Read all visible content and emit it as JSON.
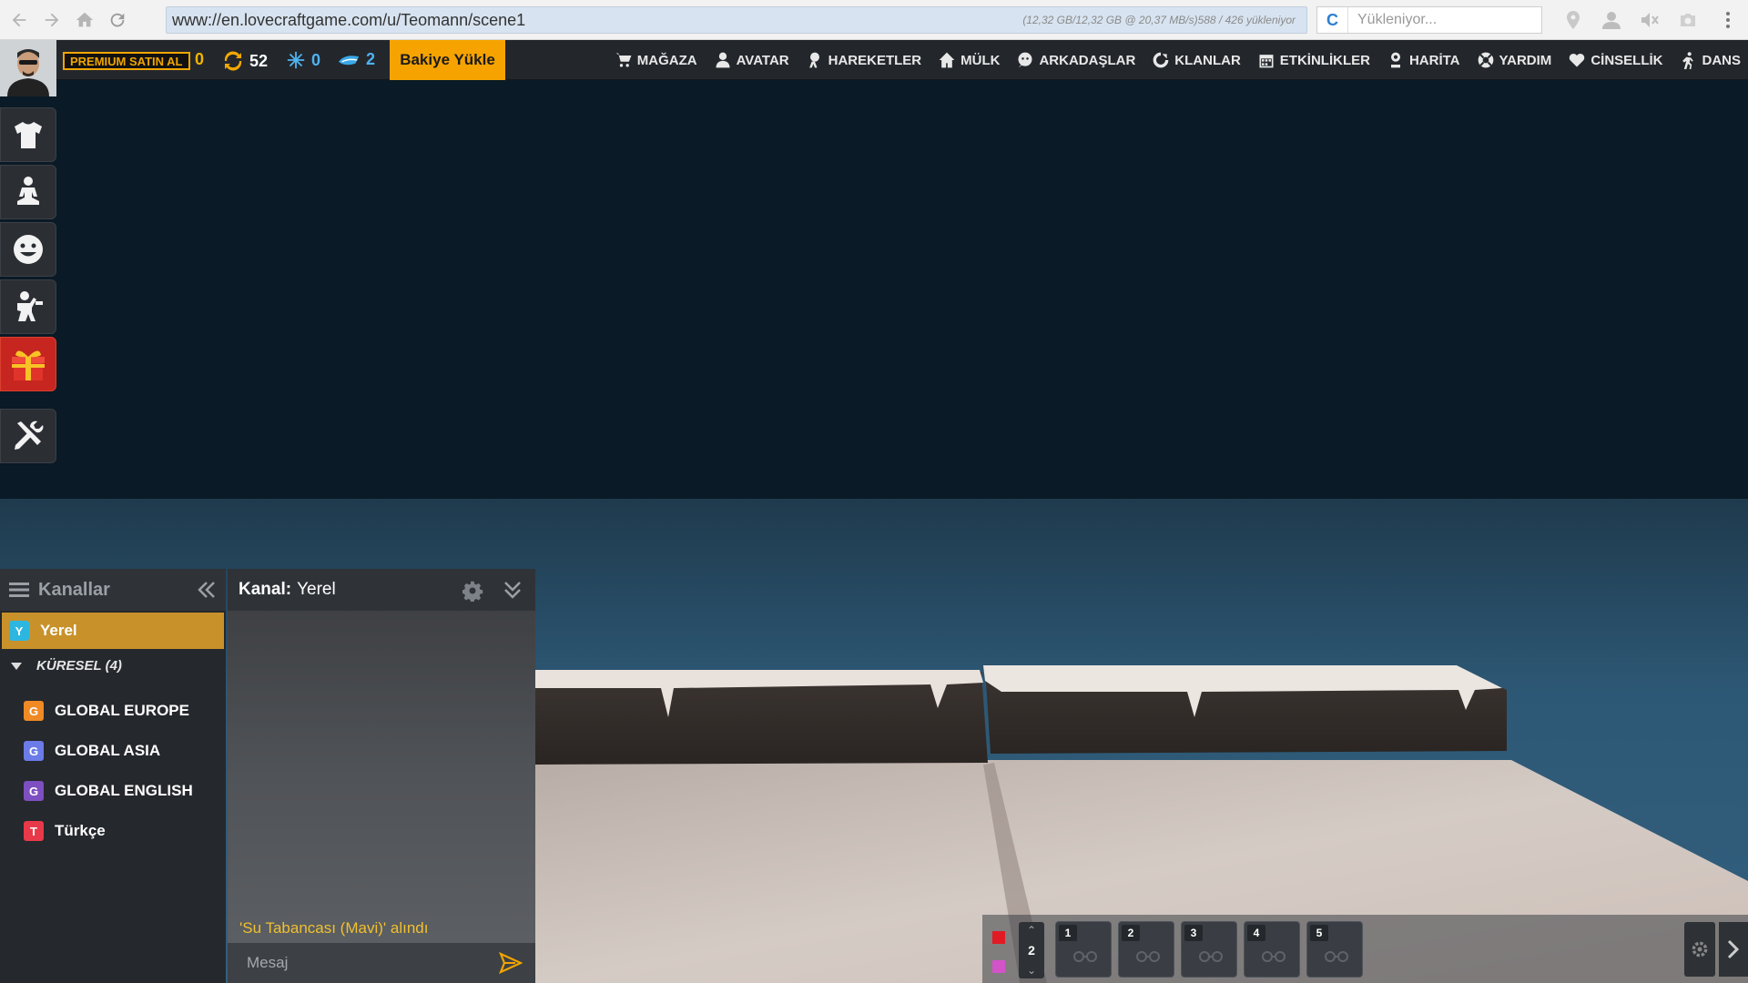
{
  "browser": {
    "url": "www://en.lovecraftgame.com/u/Teomann/scene1",
    "load_status": "(12,32 GB/12,32 GB @ 20,37 MB/s)588 / 426 yükleniyor",
    "search_placeholder": "Yükleniyor...",
    "search_engine_letter": "C"
  },
  "topbar": {
    "premium_label": "PREMIUM SATIN AL",
    "gold": "0",
    "refresh_count": "52",
    "snow_count": "0",
    "gem_count": "2",
    "bakiye_label": "Bakiye Yükle",
    "menu": [
      {
        "label": "MAĞAZA",
        "icon": "cart-icon"
      },
      {
        "label": "AVATAR",
        "icon": "person-icon"
      },
      {
        "label": "HAREKETLER",
        "icon": "moves-icon"
      },
      {
        "label": "MÜLK",
        "icon": "home-icon"
      },
      {
        "label": "ARKADAŞLAR",
        "icon": "friends-icon"
      },
      {
        "label": "KLANLAR",
        "icon": "clan-icon"
      },
      {
        "label": "ETKİNLİKLER",
        "icon": "calendar-icon"
      },
      {
        "label": "HARİTA",
        "icon": "map-pin-icon"
      },
      {
        "label": "YARDIM",
        "icon": "lifebuoy-icon"
      },
      {
        "label": "CİNSELLİK",
        "icon": "heart-icon"
      },
      {
        "label": "DANS",
        "icon": "dance-icon"
      }
    ]
  },
  "left_toolbar": [
    "shirt-icon",
    "meditate-icon",
    "smiley-icon",
    "pose-icon",
    "gift-icon",
    "tools-icon"
  ],
  "channels": {
    "title": "Kanallar",
    "active": {
      "badge": "Y",
      "label": "Yerel",
      "color": "#2db7e0"
    },
    "group_label": "KÜRESEL (4)",
    "items": [
      {
        "badge": "G",
        "label": "GLOBAL EUROPE",
        "color": "#f08a24"
      },
      {
        "badge": "G",
        "label": "GLOBAL ASIA",
        "color": "#6b7be8"
      },
      {
        "badge": "G",
        "label": "GLOBAL ENGLISH",
        "color": "#7e4fc0"
      },
      {
        "badge": "T",
        "label": "Türkçe",
        "color": "#e8394a"
      }
    ]
  },
  "chat": {
    "channel_prefix": "Kanal:",
    "channel_name": "Yerel",
    "message": "'Su Tabancası (Mavi)' alındı",
    "input_placeholder": "Mesaj"
  },
  "hotbar": {
    "page": "2",
    "slots": [
      "1",
      "2",
      "3",
      "4",
      "5"
    ],
    "swatches": [
      "#e01b24",
      "#d254c8"
    ]
  }
}
